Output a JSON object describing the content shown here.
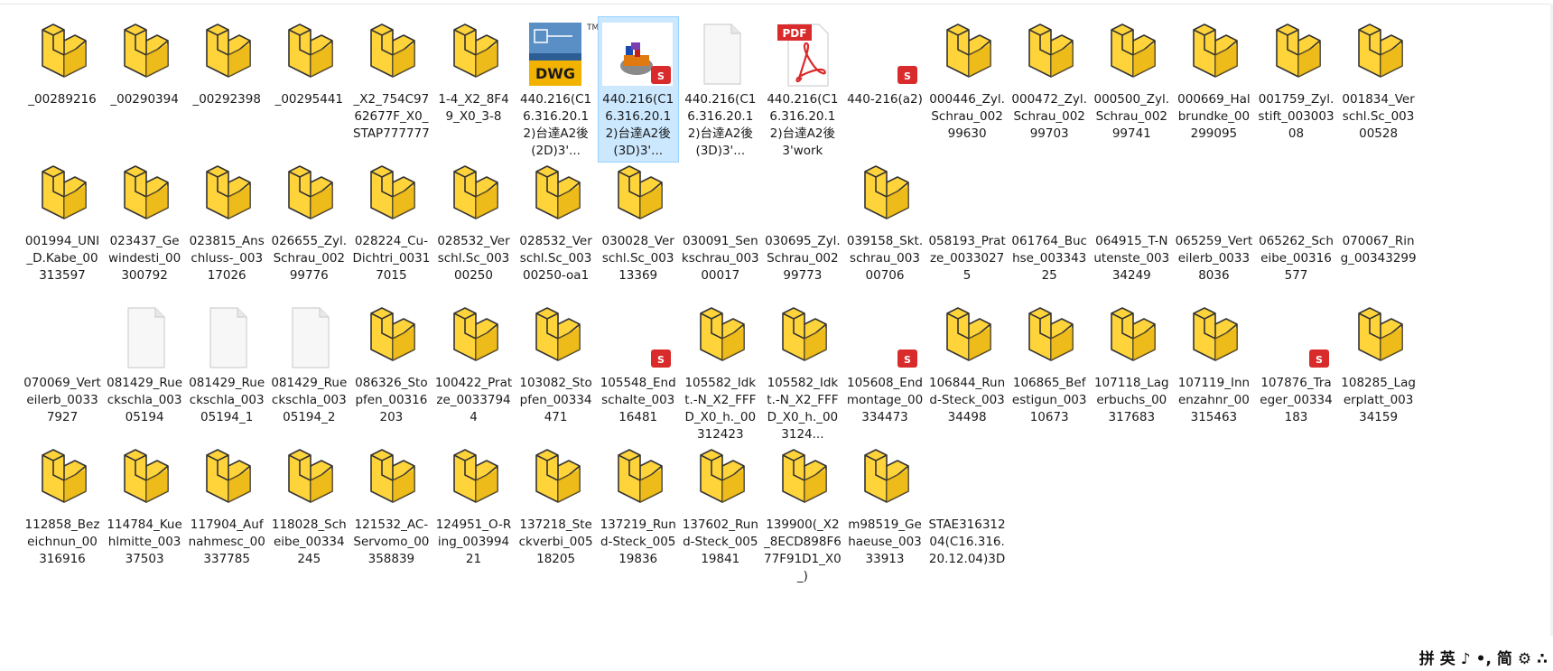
{
  "colors": {
    "folder_yellow": "#ffd43b",
    "folder_dark": "#e0a800",
    "selection": "#cce8ff",
    "sw_red": "#d92b2b"
  },
  "files": [
    {
      "label": "_00289216",
      "icon": "part-icon"
    },
    {
      "label": "_00290394",
      "icon": "part-icon"
    },
    {
      "label": "_00292398",
      "icon": "part-icon"
    },
    {
      "label": "_00295441",
      "icon": "part-icon"
    },
    {
      "label": "_X2_754C9762677F_X0_STAP777777",
      "icon": "part-icon"
    },
    {
      "label": "1-4_X2_8F49_X0_3-8",
      "icon": "part-icon"
    },
    {
      "label": "440.216(C16.316.20.12)台達A2後(2D)3'...",
      "icon": "dwg-icon",
      "badge": "DWG"
    },
    {
      "label": "440.216(C16.316.20.12)台達A2後(3D)3'...",
      "icon": "sw-assembly-icon",
      "selected": true
    },
    {
      "label": "440.216(C16.316.20.12)台達A2後(3D)3'...",
      "icon": "blank-file-icon"
    },
    {
      "label": "440.216(C16.316.20.12)台達A2後3'work",
      "icon": "pdf-icon",
      "badge": "PDF"
    },
    {
      "label": "440-216(a2)",
      "icon": "sw-badge-icon"
    },
    {
      "label": "000446_Zyl.Schrau_00299630",
      "icon": "part-icon"
    },
    {
      "label": "000472_Zyl.Schrau_00299703",
      "icon": "part-icon"
    },
    {
      "label": "000500_Zyl.Schrau_00299741",
      "icon": "part-icon"
    },
    {
      "label": "000669_Halbrundke_00299095",
      "icon": "part-icon"
    },
    {
      "label": "001759_Zyl.stift_00300308",
      "icon": "part-icon"
    },
    {
      "label": "001834_Verschl.Sc_00300528",
      "icon": "part-icon"
    },
    {
      "label": "001994_UNI_D.Kabe_00313597",
      "icon": "part-icon"
    },
    {
      "label": "023437_Gewindesti_00300792",
      "icon": "part-icon"
    },
    {
      "label": "023815_Anschluss-_00317026",
      "icon": "part-icon"
    },
    {
      "label": "026655_Zyl.Schrau_00299776",
      "icon": "part-icon"
    },
    {
      "label": "028224_Cu-Dichtri_00317015",
      "icon": "part-icon"
    },
    {
      "label": "028532_Verschl.Sc_00300250",
      "icon": "part-icon"
    },
    {
      "label": "028532_Verschl.Sc_00300250-oa1",
      "icon": "part-icon"
    },
    {
      "label": "030028_Verschl.Sc_00313369",
      "icon": "part-icon"
    },
    {
      "label": "030091_Senkschrau_00300017",
      "icon": "none"
    },
    {
      "label": "030695_Zyl.Schrau_00299773",
      "icon": "none"
    },
    {
      "label": "039158_Skt.schrau_00300706",
      "icon": "part-icon"
    },
    {
      "label": "058193_Pratze_00330275",
      "icon": "none"
    },
    {
      "label": "061764_Buchse_00334325",
      "icon": "none"
    },
    {
      "label": "064915_T-Nutenste_00334249",
      "icon": "none"
    },
    {
      "label": "065259_Verteilerb_00338036",
      "icon": "none"
    },
    {
      "label": "065262_Scheibe_00316577",
      "icon": "none"
    },
    {
      "label": "070067_Ring_00343299",
      "icon": "none"
    },
    {
      "label": "070069_Verteilerb_00337927",
      "icon": "none"
    },
    {
      "label": "081429_Rueckschla_00305194",
      "icon": "blank-file-icon"
    },
    {
      "label": "081429_Rueckschla_00305194_1",
      "icon": "blank-file-icon"
    },
    {
      "label": "081429_Rueckschla_00305194_2",
      "icon": "blank-file-icon"
    },
    {
      "label": "086326_Stopfen_00316203",
      "icon": "part-icon"
    },
    {
      "label": "100422_Pratze_00337944",
      "icon": "part-icon"
    },
    {
      "label": "103082_Stopfen_00334471",
      "icon": "part-icon"
    },
    {
      "label": "105548_Endschalte_00316481",
      "icon": "sw-badge-icon"
    },
    {
      "label": "105582_Idkt.-N_X2_FFFD_X0_h._00312423",
      "icon": "part-icon"
    },
    {
      "label": "105582_Idkt.-N_X2_FFFD_X0_h._003124...",
      "icon": "part-icon"
    },
    {
      "label": "105608_Endmontage_00334473",
      "icon": "sw-badge-icon"
    },
    {
      "label": "106844_Rund-Steck_00334498",
      "icon": "part-icon"
    },
    {
      "label": "106865_Befestigun_00310673",
      "icon": "part-icon"
    },
    {
      "label": "107118_Lagerbuchs_00317683",
      "icon": "part-icon"
    },
    {
      "label": "107119_Innenzahnr_00315463",
      "icon": "part-icon"
    },
    {
      "label": "107876_Traeger_00334183",
      "icon": "sw-badge-icon"
    },
    {
      "label": "108285_Lagerplatt_00334159",
      "icon": "part-icon"
    },
    {
      "label": "112858_Bezeichnun_00316916",
      "icon": "part-icon"
    },
    {
      "label": "114784_Kuehlmitte_00337503",
      "icon": "part-icon"
    },
    {
      "label": "117904_Aufnahmesc_00337785",
      "icon": "part-icon"
    },
    {
      "label": "118028_Scheibe_00334245",
      "icon": "part-icon"
    },
    {
      "label": "121532_AC-Servomo_00358839",
      "icon": "part-icon"
    },
    {
      "label": "124951_O-Ring_00399421",
      "icon": "part-icon"
    },
    {
      "label": "137218_Steckverbi_00518205",
      "icon": "part-icon"
    },
    {
      "label": "137219_Rund-Steck_00519836",
      "icon": "part-icon"
    },
    {
      "label": "137602_Rund-Steck_00519841",
      "icon": "part-icon"
    },
    {
      "label": "139900(_X2_8ECD898F677F91D1_X0_)",
      "icon": "part-icon"
    },
    {
      "label": "m98519_Gehaeuse_00333913",
      "icon": "part-icon"
    },
    {
      "label": "STAE31631204(C16.316.20.12.04)3D",
      "icon": "none"
    }
  ],
  "tray": {
    "items": [
      "拼",
      "英",
      "♪",
      "•,",
      "简",
      "⚙",
      "∴"
    ]
  }
}
